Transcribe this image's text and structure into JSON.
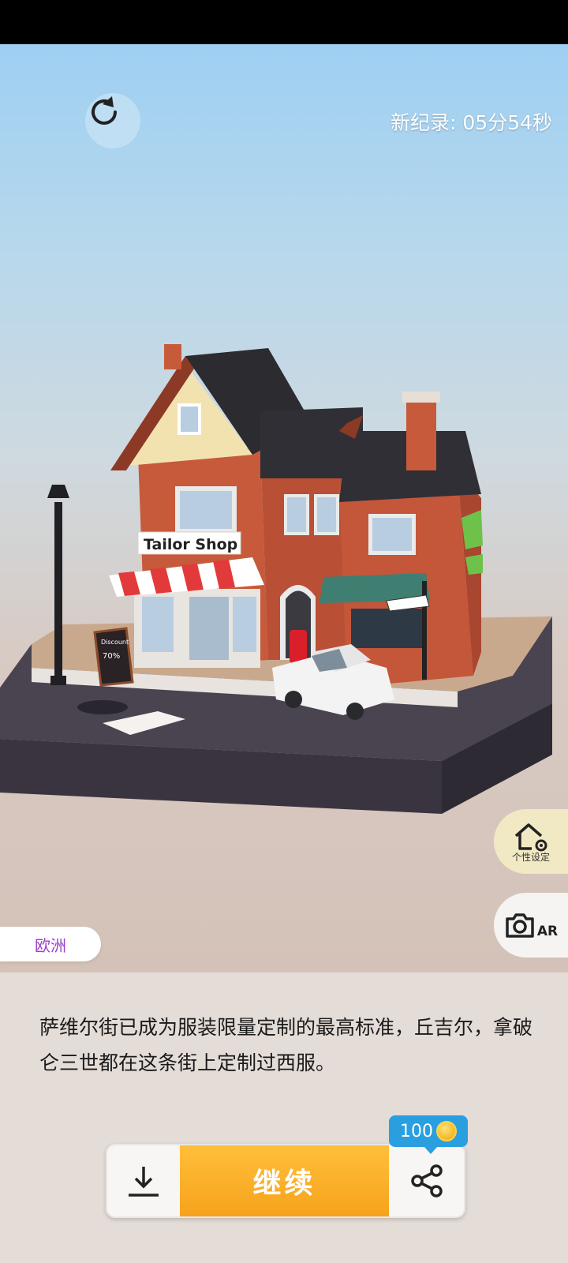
{
  "hud": {
    "record_text": "新纪录: 05分54秒"
  },
  "scene": {
    "shop_sign": "Tailor Shop",
    "board_text_1": "Discount",
    "board_text_2": "70%"
  },
  "side_buttons": {
    "customize_label": "个性设定",
    "ar_label": "AR"
  },
  "region_tag": "欧洲",
  "description": "萨维尔街已成为服装限量定制的最高标准，丘吉尔，拿破仑三世都在这条街上定制过西服。",
  "actions": {
    "continue_label": "继续",
    "share_reward": "100"
  },
  "colors": {
    "continue_button": "#f7a21c",
    "badge": "#2a9fe0",
    "region_text": "#9a3fc9"
  }
}
